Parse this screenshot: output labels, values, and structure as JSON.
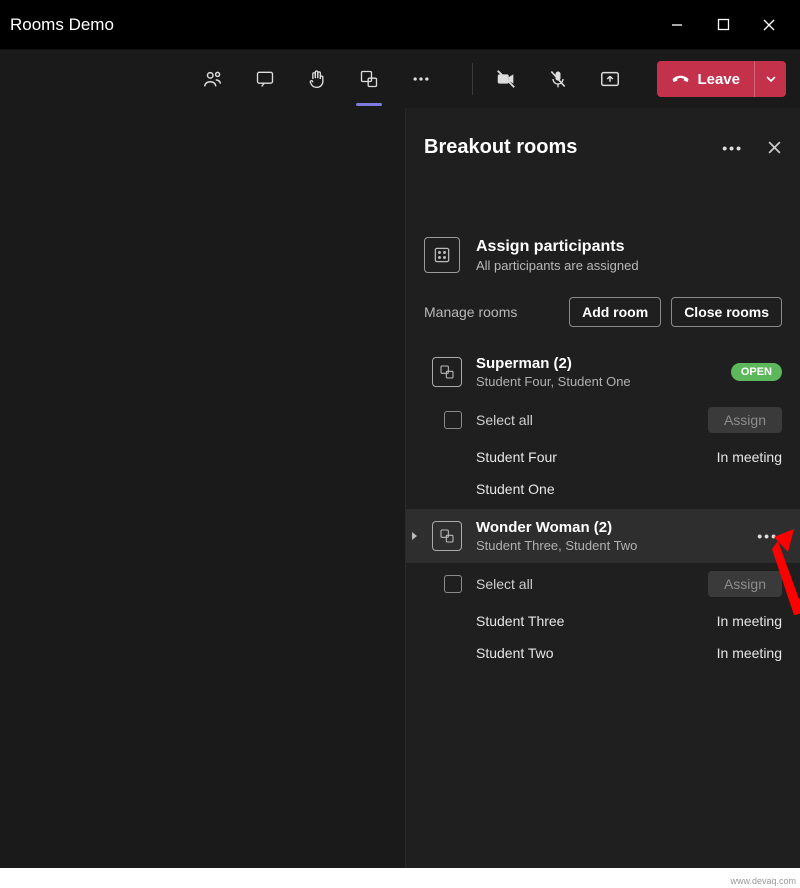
{
  "window": {
    "title": "Rooms Demo"
  },
  "toolbar": {
    "leave_label": "Leave"
  },
  "panel": {
    "title": "Breakout rooms",
    "assign_title": "Assign participants",
    "assign_subtitle": "All participants are assigned",
    "manage_label": "Manage rooms",
    "add_room_label": "Add room",
    "close_rooms_label": "Close rooms",
    "rooms": [
      {
        "name": "Superman (2)",
        "subtitle": "Student Four, Student One",
        "badge": "OPEN",
        "select_all": "Select all",
        "assign_label": "Assign",
        "members": [
          {
            "name": "Student Four",
            "status": "In meeting"
          },
          {
            "name": "Student One",
            "status": ""
          }
        ]
      },
      {
        "name": "Wonder Woman (2)",
        "subtitle": "Student Three, Student Two",
        "select_all": "Select all",
        "assign_label": "Assign",
        "members": [
          {
            "name": "Student Three",
            "status": "In meeting"
          },
          {
            "name": "Student Two",
            "status": "In meeting"
          }
        ]
      }
    ]
  },
  "watermark": "www.devaq.com"
}
